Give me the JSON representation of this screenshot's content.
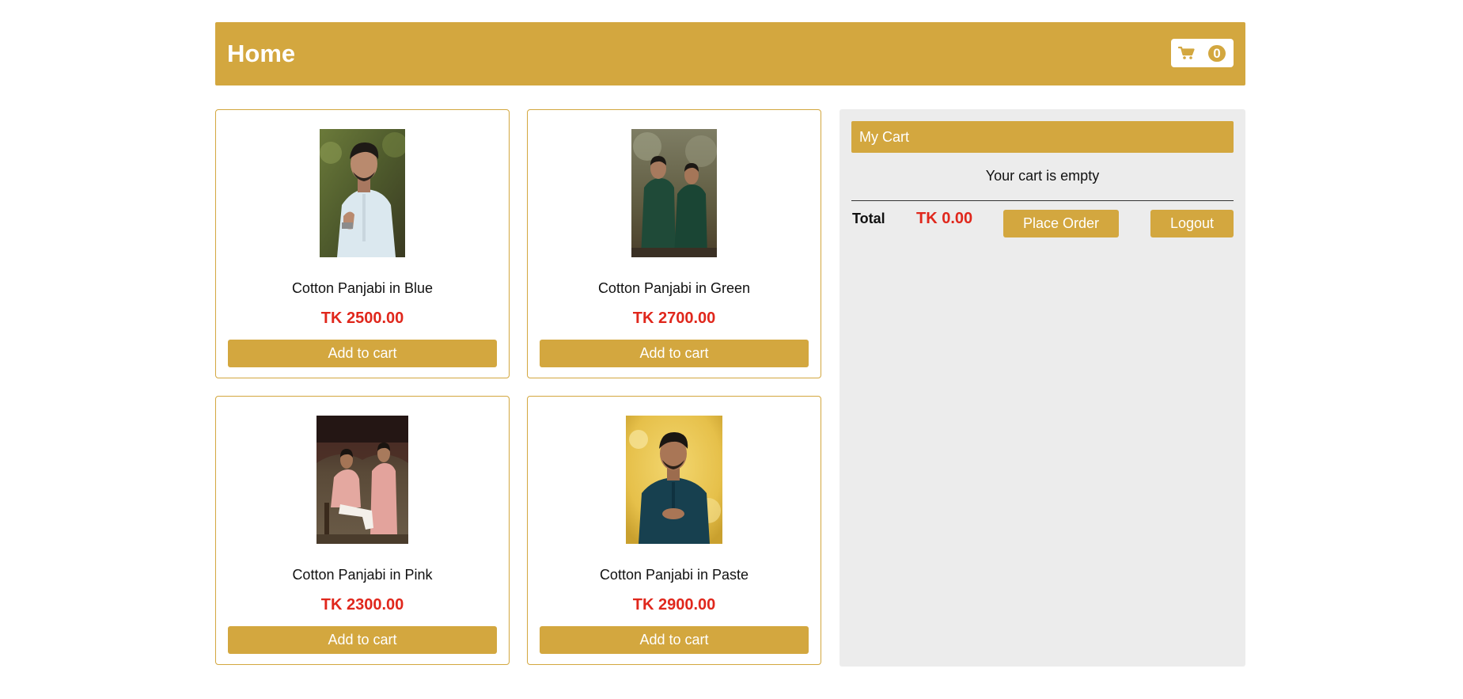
{
  "header": {
    "title": "Home",
    "cart_count": "0",
    "cart_icon": "shopping-cart-icon"
  },
  "colors": {
    "accent": "#d3a73f",
    "price": "#e0271c",
    "panel_bg": "#ececec"
  },
  "products": [
    {
      "name": "Cotton Panjabi in Blue",
      "price": "TK 2500.00",
      "button": "Add to cart"
    },
    {
      "name": "Cotton Panjabi in Green",
      "price": "TK 2700.00",
      "button": "Add to cart"
    },
    {
      "name": "Cotton Panjabi in Pink",
      "price": "TK 2300.00",
      "button": "Add to cart"
    },
    {
      "name": "Cotton Panjabi in Paste",
      "price": "TK 2900.00",
      "button": "Add to cart"
    }
  ],
  "cart": {
    "title": "My Cart",
    "empty_message": "Your cart is empty",
    "total_label": "Total",
    "total_value": "TK 0.00",
    "place_order": "Place Order",
    "logout": "Logout"
  }
}
